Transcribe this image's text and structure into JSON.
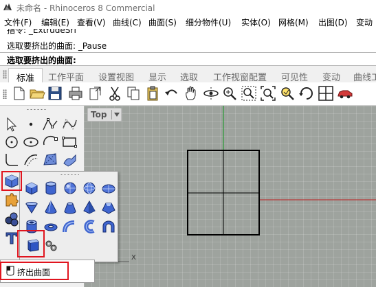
{
  "titlebar": {
    "title": "未命名 - Rhinoceros 8 Commercial"
  },
  "menu": [
    "文件(F)",
    "编辑(E)",
    "查看(V)",
    "曲线(C)",
    "曲面(S)",
    "细分物件(U)",
    "实体(O)",
    "网格(M)",
    "出图(D)",
    "变动"
  ],
  "command_history": [
    "指令: _ExtrudeSrf",
    "选取要挤出的曲面: _Pause"
  ],
  "command_prompt": "选取要挤出的曲面:",
  "toolbar_tabs": [
    "标准",
    "工作平面",
    "设置视图",
    "显示",
    "选取",
    "工作视窗配置",
    "可见性",
    "变动",
    "曲线工"
  ],
  "active_tab": "标准",
  "viewport": {
    "name": "Top",
    "axis_label": "X"
  },
  "tooltip": {
    "label": "挤出曲面"
  },
  "colors": {
    "highlight": "#e0141e",
    "grid_bg": "#9ea39e",
    "x_axis": "#b83a3a",
    "y_axis": "#2b9a36"
  },
  "main_toolbar_icons": [
    "new-file-icon",
    "open-folder-icon",
    "save-icon",
    "print-icon",
    "import-icon",
    "cut-icon",
    "copy-icon",
    "paste-icon",
    "undo-icon",
    "pan-hand-icon",
    "rotate-view-icon",
    "zoom-icon",
    "zoom-window-icon",
    "zoom-extents-icon",
    "zoom-selected-icon",
    "rotate-icon",
    "four-viewports-icon",
    "car-render-icon"
  ]
}
